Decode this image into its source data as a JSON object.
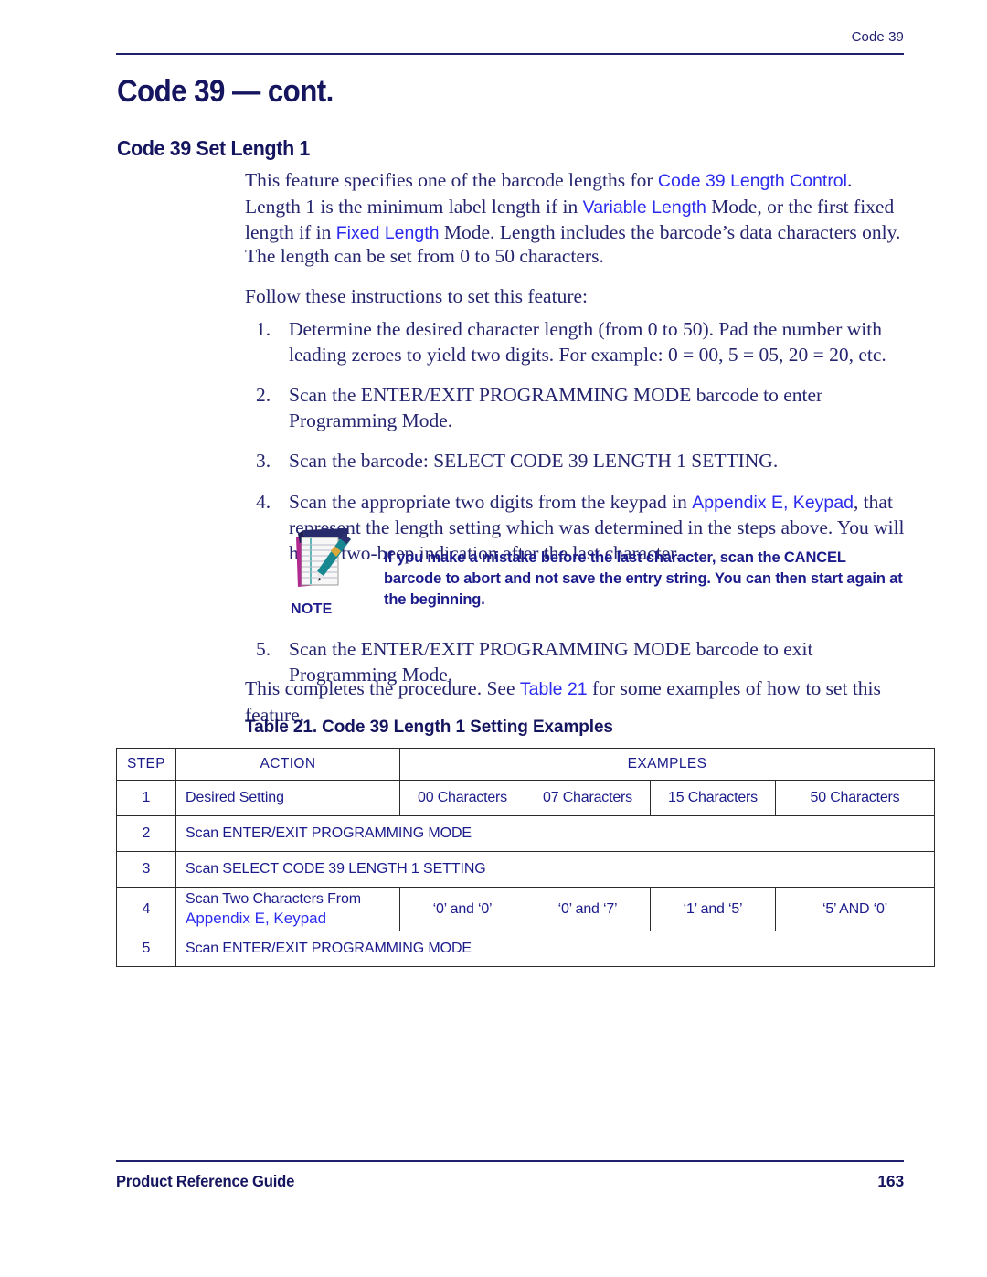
{
  "header": {
    "running_head": "Code 39"
  },
  "titles": {
    "chapter": "Code 39 — cont.",
    "section": "Code 39 Set Length 1"
  },
  "intro": {
    "part1": "This feature specifies one of the barcode lengths for ",
    "link1": "Code 39 Length Control",
    "part2": ". Length 1 is the minimum label length if in ",
    "link2": "Variable Length",
    "part3": " Mode, or the first fixed length if in ",
    "link3": "Fixed Length",
    "part4": " Mode. Length includes the barcode’s data characters only.",
    "length_line": "The length can be set from 0 to 50 characters.",
    "follow_line": "Follow these instructions to set this feature:"
  },
  "steps": [
    {
      "num": "1.",
      "text": "Determine the desired character length (from 0 to 50). Pad the number with leading zeroes to yield two digits. For example: 0 = 00, 5 = 05, 20 = 20, etc."
    },
    {
      "num": "2.",
      "text": "Scan the ENTER/EXIT PROGRAMMING MODE barcode to enter Programming Mode."
    },
    {
      "num": "3.",
      "text": "Scan the barcode: SELECT CODE 39 LENGTH 1 SETTING."
    },
    {
      "num": "4.",
      "pre": "Scan the appropriate two digits from the keypad in ",
      "link": "Appendix E, Keypad",
      "post": ", that represent the length setting which was determined in the steps above. You will hear a two-beep indication after the last character."
    }
  ],
  "note": {
    "label": "NOTE",
    "text": "If you make a mistake before the last character, scan the CANCEL barcode to abort and not save the entry string. You can then start again at the beginning."
  },
  "step5": {
    "num": "5.",
    "text": "Scan the ENTER/EXIT PROGRAMMING MODE barcode to exit Programming Mode."
  },
  "closing": {
    "pre": "This completes the procedure. See ",
    "link": "Table 21",
    "post": " for some examples of how to set this feature."
  },
  "table": {
    "caption": "Table 21. Code 39 Length 1 Setting Examples",
    "headers": {
      "step": "STEP",
      "action": "ACTION",
      "examples": "EXAMPLES"
    },
    "rows": [
      {
        "step": "1",
        "action": "Desired Setting",
        "examples": [
          "00 Characters",
          "07 Characters",
          "15 Characters",
          "50 Characters"
        ]
      },
      {
        "step": "2",
        "action": "Scan ENTER/EXIT PROGRAMMING MODE",
        "examples": []
      },
      {
        "step": "3",
        "action": "Scan SELECT CODE 39 LENGTH 1 SETTING",
        "examples": []
      },
      {
        "step": "4",
        "action": "Scan Two Characters From",
        "action_link": "Appendix E, Keypad",
        "examples": [
          "‘0’ and ‘0’",
          "‘0’ and ‘7’",
          "‘1’ and ‘5’",
          "‘5’ AND ‘0’"
        ]
      },
      {
        "step": "5",
        "action": "Scan ENTER/EXIT PROGRAMMING MODE",
        "examples": []
      }
    ]
  },
  "footer": {
    "left": "Product Reference Guide",
    "page": "163"
  },
  "colors": {
    "navy": "#15155f",
    "body": "#25256f",
    "link": "#2b2bef",
    "note": "#1b1b8c",
    "rule": "#21216b"
  }
}
